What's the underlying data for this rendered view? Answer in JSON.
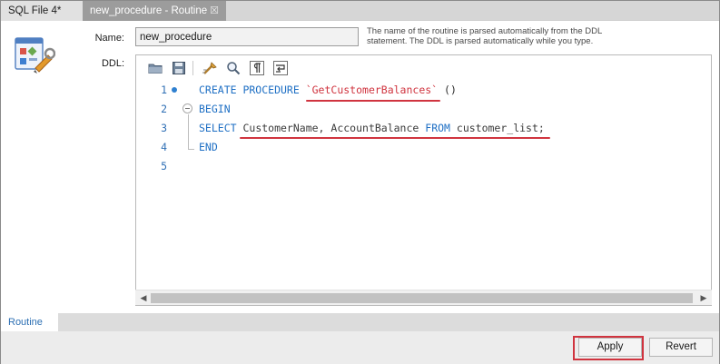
{
  "tabs": [
    {
      "label": "SQL File 4*",
      "active": false
    },
    {
      "label": "new_procedure - Routine",
      "active": true,
      "close_glyph": "☒"
    }
  ],
  "form": {
    "name_label": "Name:",
    "name_value": "new_procedure",
    "ddl_label": "DDL:",
    "hint": "The name of the routine is parsed automatically from the DDL statement. The DDL is parsed automatically while you type."
  },
  "editor": {
    "toolbar_icons": [
      "open-folder-icon",
      "save-icon",
      "beautify-icon",
      "find-icon",
      "invisible-chars-icon",
      "wrap-icon"
    ],
    "lines": [
      {
        "num": "1",
        "tokens": [
          {
            "t": "CREATE PROCEDURE ",
            "c": "kw"
          },
          {
            "t": "`GetCustomerBalances`",
            "c": "str"
          },
          {
            "t": " ()",
            "c": "plain"
          }
        ]
      },
      {
        "num": "2",
        "tokens": [
          {
            "t": "BEGIN",
            "c": "kw"
          }
        ]
      },
      {
        "num": "3",
        "tokens": [
          {
            "t": "SELECT ",
            "c": "kw"
          },
          {
            "t": "CustomerName, AccountBalance ",
            "c": "id"
          },
          {
            "t": "FROM ",
            "c": "kw"
          },
          {
            "t": "customer_list;",
            "c": "id"
          }
        ]
      },
      {
        "num": "4",
        "tokens": [
          {
            "t": "END",
            "c": "kw"
          }
        ]
      },
      {
        "num": "5",
        "tokens": []
      }
    ]
  },
  "bottom_tab": {
    "label": "Routine"
  },
  "actions": {
    "apply_label": "Apply",
    "revert_label": "Revert"
  },
  "colors": {
    "keyword": "#1e6fc4",
    "string": "#d0343f",
    "highlight": "#d0343f"
  }
}
